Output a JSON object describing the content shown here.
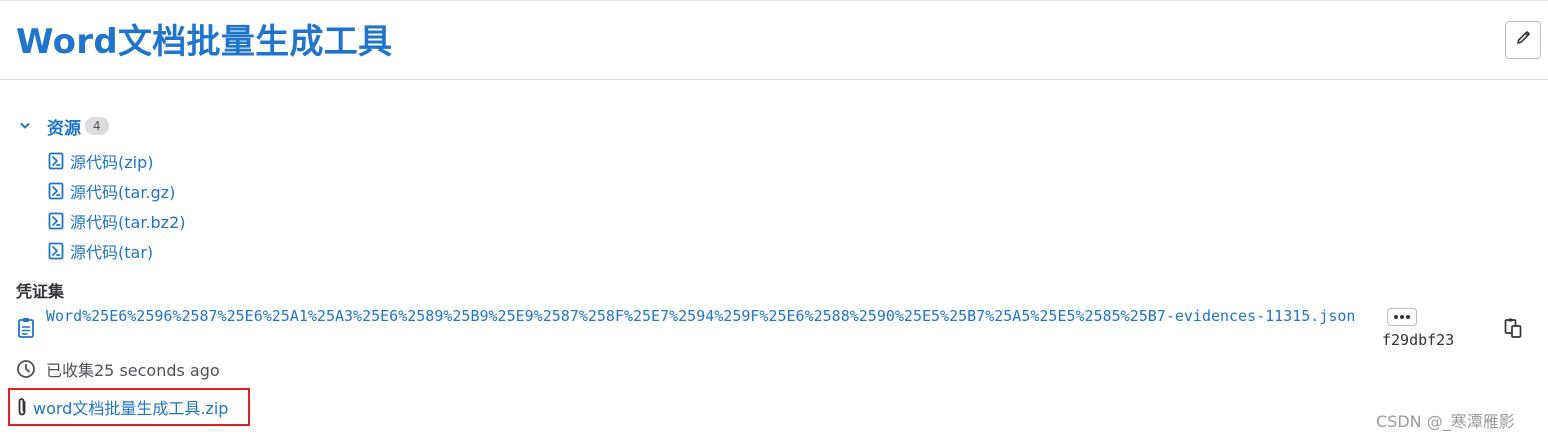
{
  "page": {
    "title": "Word文档批量生成工具"
  },
  "assets": {
    "label": "资源",
    "count": "4",
    "links": [
      {
        "label": "源代码(zip)"
      },
      {
        "label": "源代码(tar.gz)"
      },
      {
        "label": "源代码(tar.bz2)"
      },
      {
        "label": "源代码(tar)"
      }
    ]
  },
  "evidence": {
    "heading": "凭证集",
    "filename": "Word%25E6%2596%2587%25E6%25A1%25A3%25E6%2589%25B9%25E9%2587%258F%25E7%2594%259F%25E6%2588%2590%25E5%25B7%25A5%25E5%2585%25B7-evidences-11315.json",
    "sha": "f29dbf23",
    "collected": "已收集25 seconds ago"
  },
  "attachment": {
    "label": "word文档批量生成工具.zip"
  },
  "watermark": "CSDN @_寒潭雁影",
  "colors": {
    "link": "#1f75cb",
    "highlight_border": "#e02020",
    "badge_bg": "#dcdcde"
  },
  "icons": [
    "pencil-icon",
    "chevron-down-icon",
    "archive-file-icon",
    "clipboard-icon",
    "more-dots-icon",
    "copy-icon",
    "clock-icon",
    "paperclip-icon"
  ]
}
